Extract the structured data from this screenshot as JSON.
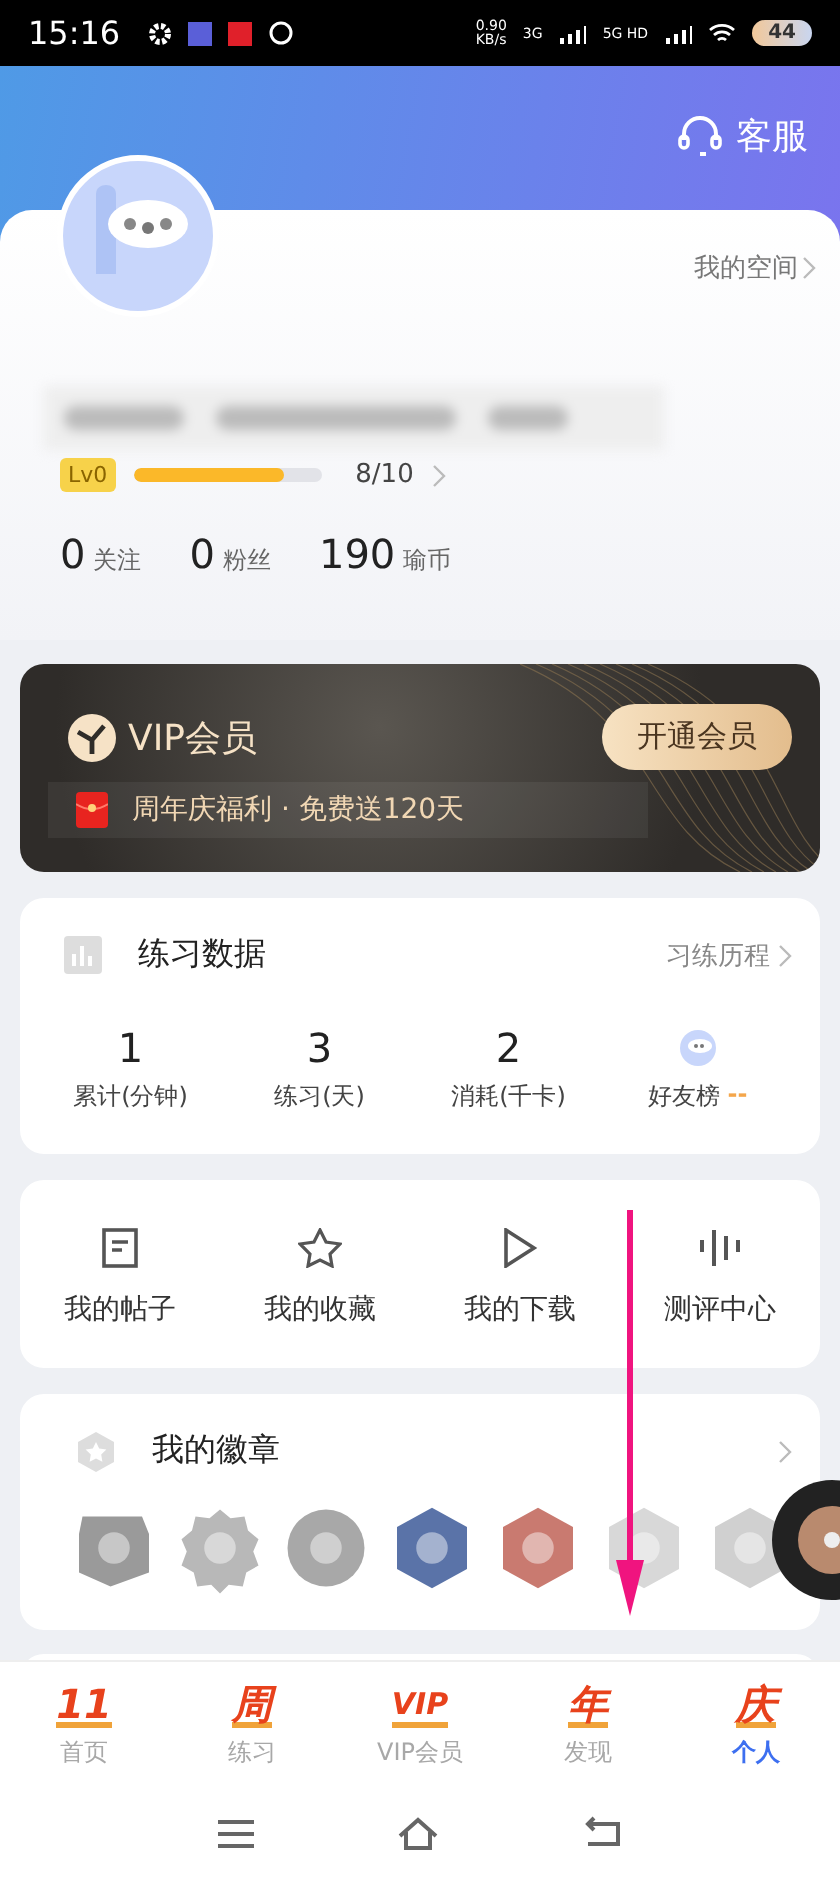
{
  "status_bar": {
    "time": "15:16",
    "speed": "0.90",
    "speed_unit": "KB/s",
    "network_1": "3G",
    "network_2": "5G HD",
    "battery": "44"
  },
  "header": {
    "service": "客服"
  },
  "profile": {
    "space_link": "我的空间",
    "level_badge": "Lv0",
    "level": 0.8,
    "progress": "8/10",
    "stats": [
      {
        "value": "0",
        "label": "关注"
      },
      {
        "value": "0",
        "label": "粉丝"
      },
      {
        "value": "190",
        "label": "瑜币"
      }
    ]
  },
  "vip": {
    "title": "VIP会员",
    "button": "开通会员",
    "promo": "周年庆福利 · 免费送120天"
  },
  "practice": {
    "title": "练习数据",
    "link": "习练历程",
    "stats": [
      {
        "kind": "number",
        "value": "1",
        "label": "累计(分钟)"
      },
      {
        "kind": "number",
        "value": "3",
        "label": "练习(天)"
      },
      {
        "kind": "number",
        "value": "2",
        "label": "消耗(千卡)"
      },
      {
        "kind": "ranking",
        "label": "好友榜",
        "value": "--"
      }
    ]
  },
  "shortcuts": [
    {
      "kind": "post",
      "label": "我的帖子"
    },
    {
      "kind": "star",
      "label": "我的收藏"
    },
    {
      "kind": "play",
      "label": "我的下载"
    },
    {
      "kind": "bars",
      "label": "测评中心"
    }
  ],
  "badges": {
    "title": "我的徽章",
    "items": [
      {
        "kind": "shield",
        "color": "#9a9a9a"
      },
      {
        "kind": "gear",
        "color": "#b8b8b8"
      },
      {
        "kind": "circle",
        "color": "#a8a8a8"
      },
      {
        "kind": "hexagon",
        "color": "#5a73a8"
      },
      {
        "kind": "hexagon",
        "color": "#c97a70"
      },
      {
        "kind": "hexagon",
        "color": "#d8d8d8"
      },
      {
        "kind": "hexagon",
        "color": "#d0d0d0"
      }
    ]
  },
  "tab_bar": [
    {
      "icon_text": "11",
      "label": "首页",
      "selected": false
    },
    {
      "icon_text": "周",
      "label": "练习",
      "selected": false
    },
    {
      "icon_text": "VIP",
      "label": "VIP会员",
      "selected": false
    },
    {
      "icon_text": "年",
      "label": "发现",
      "selected": false
    },
    {
      "icon_text": "庆",
      "label": "个人",
      "selected": true
    }
  ]
}
